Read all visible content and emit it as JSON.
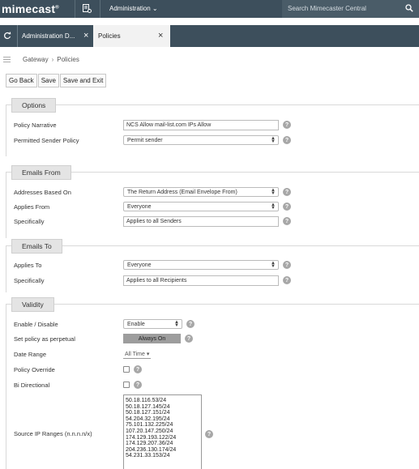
{
  "topbar": {
    "logo": "mimecast",
    "menu_label": "Administration",
    "search_placeholder": "Search Mimecaster Central"
  },
  "tabs": [
    {
      "label": "Administration D..."
    },
    {
      "label": "Policies"
    }
  ],
  "breadcrumb": [
    "Gateway",
    "Policies"
  ],
  "toolbar": {
    "back": "Go Back",
    "save": "Save",
    "save_exit": "Save and Exit"
  },
  "options": {
    "title": "Options",
    "narrative_label": "Policy Narrative",
    "narrative_value": "NCS Allow mail-list.com IPs Allow",
    "sender_policy_label": "Permitted Sender Policy",
    "sender_policy_value": "Permit sender"
  },
  "emails_from": {
    "title": "Emails From",
    "based_on_label": "Addresses Based On",
    "based_on_value": "The Return Address (Email Envelope From)",
    "applies_label": "Applies From",
    "applies_value": "Everyone",
    "specifically_label": "Specifically",
    "specifically_value": "Applies to all Senders"
  },
  "emails_to": {
    "title": "Emails To",
    "applies_label": "Applies To",
    "applies_value": "Everyone",
    "specifically_label": "Specifically",
    "specifically_value": "Applies to all Recipients"
  },
  "validity": {
    "title": "Validity",
    "enable_label": "Enable / Disable",
    "enable_value": "Enable",
    "perpetual_label": "Set policy as perpetual",
    "perpetual_value": "Always On",
    "date_range_label": "Date Range",
    "date_range_value": "All Time",
    "override_label": "Policy Override",
    "bidirectional_label": "Bi Directional",
    "ip_ranges_label": "Source IP Ranges (n.n.n.n/x)",
    "ip_ranges": [
      "50.18.116.53/24",
      "50.18.127.145/24",
      "50.18.127.151/24",
      "54.204.32.195/24",
      "75.101.132.225/24",
      "107.20.147.250/24",
      "174.129.193.122/24",
      "174.129.207.36/24",
      "204.236.130.174/24",
      "54.231.33.153/24"
    ]
  },
  "help_glyph": "?",
  "colors": {
    "nav_bg": "#3d4f5c",
    "section_title_bg": "#e4e4e4",
    "toggle_bg": "#9d9d9d"
  }
}
